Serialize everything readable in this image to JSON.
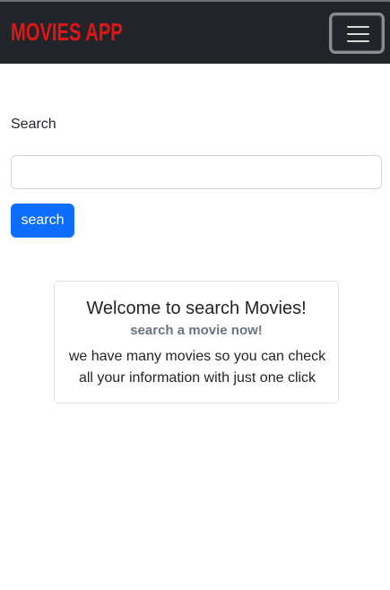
{
  "navbar": {
    "brand": "MOVIES APP",
    "brand_color": "#e01616",
    "background": "#212529",
    "toggler_icon": "hamburger-menu-icon"
  },
  "search": {
    "label": "Search",
    "input_value": "",
    "placeholder": "",
    "button_label": "search",
    "button_color": "#0d6efd"
  },
  "card": {
    "title": "Welcome to search Movies!",
    "subtitle": "search a movie now!",
    "text": "we have many movies so you can check all your information with just one click"
  }
}
